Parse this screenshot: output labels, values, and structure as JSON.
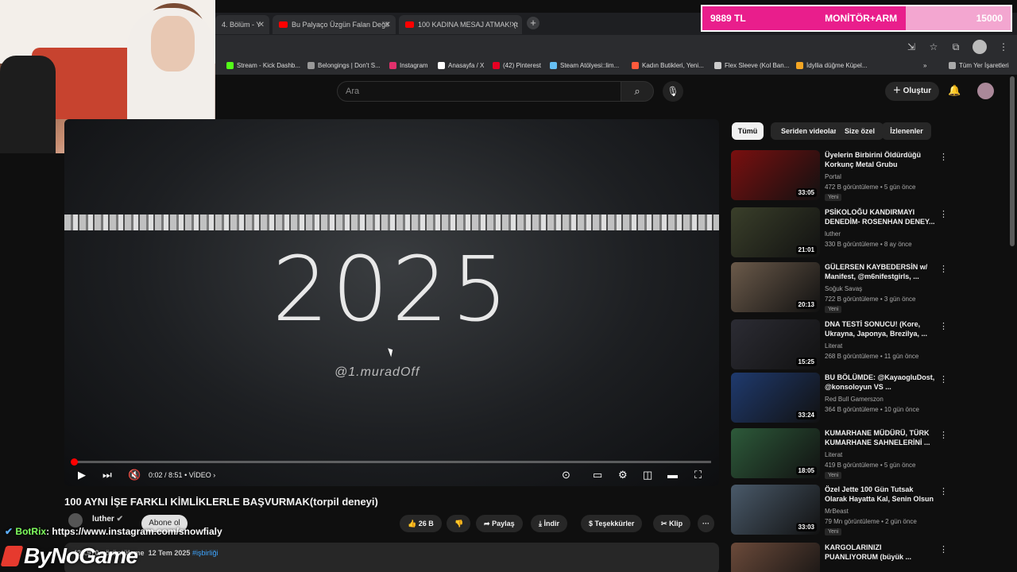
{
  "browser": {
    "tabs": [
      {
        "label": "4. Bölüm - Y"
      },
      {
        "label": "Bu Palyaço Üzgün Falan Değil"
      },
      {
        "label": "100 KADINA MESAJ ATMAK! (t"
      }
    ],
    "new_tab": "+",
    "bookmarks": [
      {
        "label": "Stream - Kick Dashb...",
        "color": "#53fc18"
      },
      {
        "label": "Belongings | Don't S...",
        "color": "#999999"
      },
      {
        "label": "Instagram",
        "color": "#e1306c"
      },
      {
        "label": "Anasayfa / X",
        "color": "#ffffff"
      },
      {
        "label": "(42) Pinterest",
        "color": "#e60023"
      },
      {
        "label": "Steam Atölyesi::lim...",
        "color": "#66c0f4"
      },
      {
        "label": "Kadın Butikleri, Yeni...",
        "color": "#ff5a3c"
      },
      {
        "label": "Flex Sleeve (Kol Ban...",
        "color": "#cccccc"
      },
      {
        "label": "İdyllia düğme Küpel...",
        "color": "#f5a623"
      }
    ],
    "bookmarks_more": "»",
    "all_bookmarks": "Tüm Yer İşaretleri"
  },
  "donation_goal": {
    "current": "9889 TL",
    "label": "MONİTÖR+ARM",
    "target": "15000"
  },
  "youtube": {
    "search_placeholder": "Ara",
    "create_label": "Oluştur"
  },
  "player": {
    "overlay_text": "2025",
    "watermark": "@1.muradOff",
    "time": "0:02 / 8:51",
    "chapter": "• VİDEO ›"
  },
  "video": {
    "title": "100 AYNI İŞE FARKLI KİMLİKLERLE BAŞVURMAK(torpil deneyi)",
    "channel": "luther",
    "subscribe": "Abone ol",
    "likes": "26 B",
    "share": "Paylaş",
    "download": "İndir",
    "thanks": "Teşekkürler",
    "clip": "Klip",
    "more": "···",
    "views": "428.970 görüntüleme",
    "date": "12 Tem 2025",
    "hashtag": "#işbirliği"
  },
  "chat": {
    "user": "BotRix",
    "message": ": https://www.instagram.com/snowfialy"
  },
  "brand": "ByNoGame",
  "chips": [
    "Tümü",
    "Seriden videolar",
    "Size özel",
    "İzlenenler"
  ],
  "recommendations": [
    {
      "title": "Üyelerin Birbirini Öldürdüğü Korkunç Metal Grubu",
      "channel": "Portal",
      "meta": "472 B görüntüleme • 5 gün önce",
      "duration": "33:05",
      "badge": "Yeni",
      "color": "#7a0f0f"
    },
    {
      "title": "PSİKOLOĞU KANDIRMAYI DENEDİM- ROSENHAN DENEY...",
      "channel": "luther",
      "meta": "330 B görüntüleme • 8 ay önce",
      "duration": "21:01",
      "badge": "",
      "color": "#3a3f2a"
    },
    {
      "title": "GÜLERSEN KAYBEDERSİN w/ Manifest, @m6nifestgirls, ...",
      "channel": "Soğuk Savaş",
      "meta": "722 B görüntüleme • 3 gün önce",
      "duration": "20:13",
      "badge": "Yeni",
      "color": "#6b5a4a"
    },
    {
      "title": "DNA TESTİ SONUCU! (Kore, Ukrayna, Japonya, Brezilya, ...",
      "channel": "Literat",
      "meta": "268 B görüntüleme • 11 gün önce",
      "duration": "15:25",
      "badge": "",
      "color": "#2c2c34"
    },
    {
      "title": "BU BÖLÜMDE: @KayaogluDost, @konsoloyun VS ...",
      "channel": "Red Bull Gamerszon",
      "meta": "364 B görüntüleme • 10 gün önce",
      "duration": "33:24",
      "badge": "",
      "color": "#1f3a6e"
    },
    {
      "title": "KUMARHANE MÜDÜRÜ, TÜRK KUMARHANE SAHNELERİNİ ...",
      "channel": "Literat",
      "meta": "419 B görüntüleme • 5 gün önce",
      "duration": "18:05",
      "badge": "Yeni",
      "color": "#2d5a3a"
    },
    {
      "title": "Özel Jette 100 Gün Tutsak Olarak Hayatta Kal, Senin Olsun",
      "channel": "MrBeast",
      "meta": "79 Mn görüntüleme • 2 gün önce",
      "duration": "33:03",
      "badge": "Yeni",
      "color": "#4a5a6a"
    },
    {
      "title": "KARGOLARINIZI PUANLIYORUM (büyük ...",
      "channel": "",
      "meta": "",
      "duration": "",
      "badge": "",
      "color": "#6b4a3a"
    }
  ]
}
